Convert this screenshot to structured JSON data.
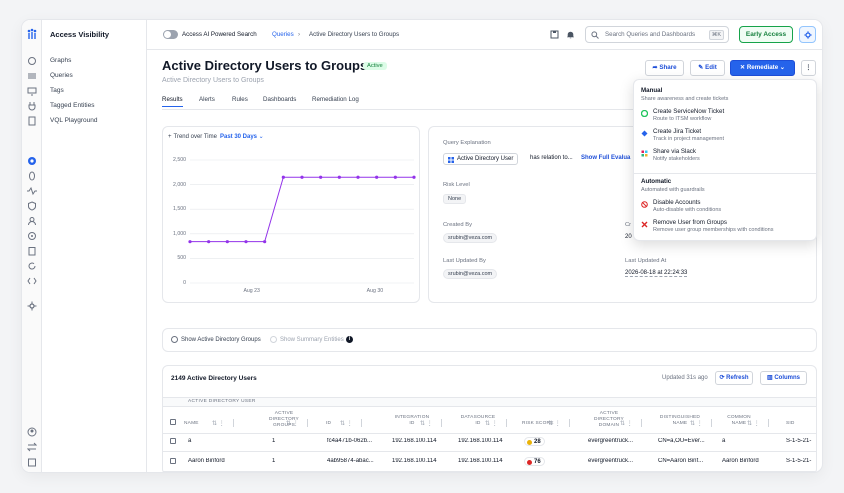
{
  "app": {
    "title": "Access Visibility"
  },
  "sidenav": {
    "items": [
      "Graphs",
      "Queries",
      "Tags",
      "Tagged Entities",
      "VQL Playground"
    ]
  },
  "topbar": {
    "toggle_label": "Access AI Powered Search",
    "breadcrumb": [
      "Queries",
      "Active Directory Users to Groups"
    ],
    "search_placeholder": "Search Queries and Dashboards",
    "search_shortcut": "⌘K",
    "early_access": "Early Access"
  },
  "header": {
    "title": "Active Directory Users to Groups",
    "status": "Active",
    "subtitle": "Active Directory Users to Groups",
    "share": "Share",
    "edit": "Edit",
    "remediate": "Remediate",
    "more": "⋮"
  },
  "tabs": [
    "Results",
    "Alerts",
    "Rules",
    "Dashboards",
    "Remediation Log"
  ],
  "trend": {
    "label": "Trend over Time",
    "range": "Past 30 Days"
  },
  "chart_data": {
    "type": "line",
    "title": "",
    "xlabel": "",
    "ylabel": "",
    "x": [
      1,
      2,
      3,
      4,
      5,
      6,
      7,
      8,
      9,
      10,
      11,
      12,
      13
    ],
    "x_ticks": [
      {
        "x": 4.4,
        "label": "Aug 23"
      },
      {
        "x": 11,
        "label": "Aug 30"
      }
    ],
    "ylim": [
      0,
      2500
    ],
    "y_ticks": [
      "0",
      "500",
      "1,000",
      "1,500",
      "2,000",
      "2,500"
    ],
    "series": [
      {
        "values": [
          840,
          840,
          840,
          840,
          840,
          2149,
          2149,
          2149,
          2149,
          2149,
          2149,
          2149,
          2149
        ]
      }
    ],
    "color": "#9333ea",
    "grid": true
  },
  "details": {
    "query_explanation_label": "Query Explanation",
    "qe_entity": "Active Directory User",
    "qe_text": "has relation to...",
    "qe_link": "Show Full Evalua",
    "risk_label": "Risk Level",
    "risk_value": "None",
    "created_by_label": "Created By",
    "created_by": "srubin@veza.com",
    "created_at_partial": "Cr",
    "created_at_value_partial": "20",
    "updated_by_label": "Last Updated By",
    "updated_by": "srubin@veza.com",
    "updated_at_label": "Last Updated At",
    "updated_at": "2026-08-18 at 22:24:33"
  },
  "remediate_menu": {
    "manual_heading": "Manual",
    "manual_sub": "Share awareness and create tickets",
    "manual_items": [
      {
        "title": "Create ServiceNow Ticket",
        "desc": "Route to ITSM workflow"
      },
      {
        "title": "Create Jira Ticket",
        "desc": "Track in project management"
      },
      {
        "title": "Share via Slack",
        "desc": "Notify stakeholders"
      }
    ],
    "auto_heading": "Automatic",
    "auto_sub": "Automated with guardrails",
    "auto_items": [
      {
        "title": "Disable Accounts",
        "desc": "Auto-disable with conditions"
      },
      {
        "title": "Remove User from Groups",
        "desc": "Remove user group memberships with conditions"
      }
    ]
  },
  "options": {
    "show_groups": "Show Active Directory Groups",
    "show_summary": "Show Summary Entities"
  },
  "table": {
    "title": "2149 Active Directory Users",
    "updated": "Updated 31s ago",
    "refresh": "Refresh",
    "columns_btn": "Columns",
    "group_label": "ACTIVE DIRECTORY USER",
    "headers": [
      "NAME",
      "ACTIVE DIRECTORY GROUPS",
      "ID",
      "INTEGRATION ID",
      "DATASOURCE ID",
      "RISK SCORE",
      "ACTIVE DIRECTORY DOMAIN",
      "DISTINGUISHED NAME",
      "COMMON NAME",
      "SID"
    ],
    "rows": [
      {
        "name": "a",
        "groups": "1",
        "id": "fc4a471b-062b...",
        "integration": "192.168.100.114",
        "datasource": "192.168.100.114",
        "risk": "28",
        "risk_color": "#eab308",
        "domain": "evergreentruck...",
        "dn": "CN=a,OU=Ever...",
        "cn": "a",
        "sid": "S-1-5-21-"
      },
      {
        "name": "Aaron Binford",
        "groups": "1",
        "id": "4ab95874-abac...",
        "integration": "192.168.100.114",
        "datasource": "192.168.100.114",
        "risk": "76",
        "risk_color": "#dc2626",
        "domain": "evergreentruck...",
        "dn": "CN=Aaron Binf...",
        "cn": "Aaron Binford",
        "sid": "S-1-5-21-"
      }
    ]
  }
}
